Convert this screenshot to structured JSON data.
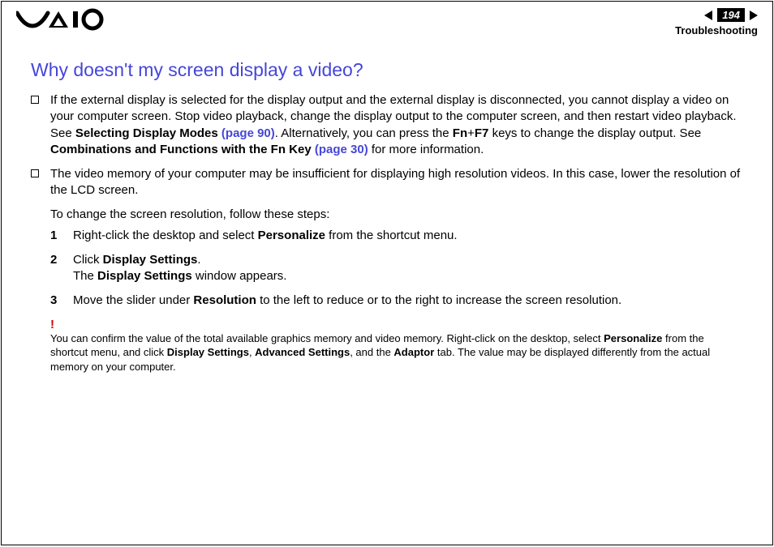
{
  "header": {
    "page_number": "194",
    "section": "Troubleshooting"
  },
  "title": "Why doesn't my screen display a video?",
  "bullet1": {
    "a": "If the external display is selected for the display output and the external display is disconnected, you cannot display a video on your computer screen. Stop video playback, change the display output to the computer screen, and then restart video playback. See ",
    "b": "Selecting Display Modes ",
    "c": "(page 90)",
    "d": ". Alternatively, you can press the ",
    "e": "Fn",
    "f": "+",
    "g": "F7",
    "h": " keys to change the display output. See ",
    "i": "Combinations and Functions with the Fn Key ",
    "j": "(page 30)",
    "k": " for more information."
  },
  "bullet2": "The video memory of your computer may be insufficient for displaying high resolution videos. In this case, lower the resolution of the LCD screen.",
  "intro": "To change the screen resolution, follow these steps:",
  "step1": {
    "a": "Right-click the desktop and select ",
    "b": "Personalize",
    "c": " from the shortcut menu."
  },
  "step2": {
    "a": "Click ",
    "b": "Display Settings",
    "c": ".",
    "d": "The ",
    "e": "Display Settings",
    "f": " window appears."
  },
  "step3": {
    "a": "Move the slider under ",
    "b": "Resolution",
    "c": " to the left to reduce or to the right to increase the screen resolution."
  },
  "bang": "!",
  "note": {
    "a": "You can confirm the value of the total available graphics memory and video memory. Right-click on the desktop, select ",
    "b": "Personalize",
    "c": " from the shortcut menu, and click ",
    "d": "Display Settings",
    "e": ", ",
    "f": "Advanced Settings",
    "g": ", and the ",
    "h": "Adaptor",
    "i": " tab. The value may be displayed differently from the actual memory on your computer."
  }
}
